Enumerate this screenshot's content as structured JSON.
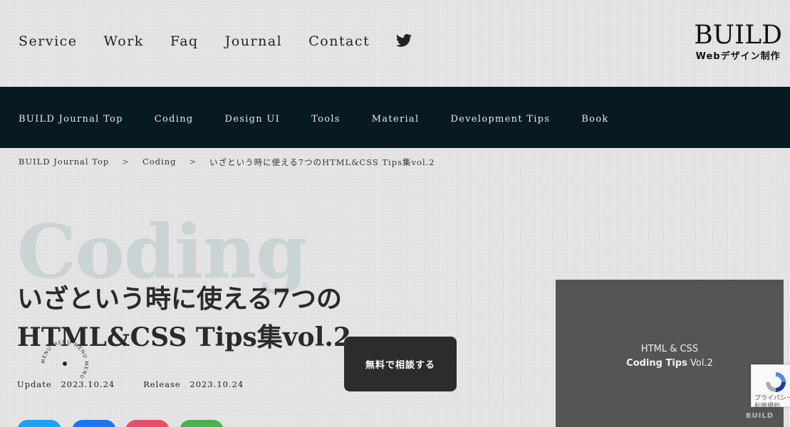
{
  "header": {
    "nav": [
      "Service",
      "Work",
      "Faq",
      "Journal",
      "Contact"
    ],
    "twitter_icon": "twitter-icon",
    "logo_word": "BUILD",
    "logo_sub": "Webデザイン制作"
  },
  "categories": [
    "BUILD Journal Top",
    "Coding",
    "Design UI",
    "Tools",
    "Material",
    "Development Tips",
    "Book"
  ],
  "breadcrumb": {
    "items": [
      "BUILD Journal Top",
      "Coding",
      "いざという時に使える7つのHTML&CSS Tips集vol.2"
    ],
    "separator": ">"
  },
  "article": {
    "category_bg": "Coding",
    "title_line1": "いざという時に使える7つの",
    "title_line2": "HTML&CSS Tips集vol.2",
    "update_label": "Update",
    "update_date": "2023.10.24",
    "release_label": "Release",
    "release_date": "2023.10.24"
  },
  "cta": {
    "label": "無料で相談する"
  },
  "menu_circle": {
    "text": "MENU MENU MENU MENU"
  },
  "thumbnail": {
    "line1": "HTML & CSS",
    "line2_bold": "Coding Tips",
    "line2_rest": " Vol.2",
    "brand": "BUILD"
  },
  "recaptcha": {
    "line1": "プライバシー",
    "line2": "利用規約"
  },
  "share_colors": [
    "#1da1f2",
    "#1877f2",
    "#e84f6b",
    "#4caf50"
  ],
  "colors": {
    "nav_bar": "#071a24",
    "cta": "#2c2c2c"
  }
}
